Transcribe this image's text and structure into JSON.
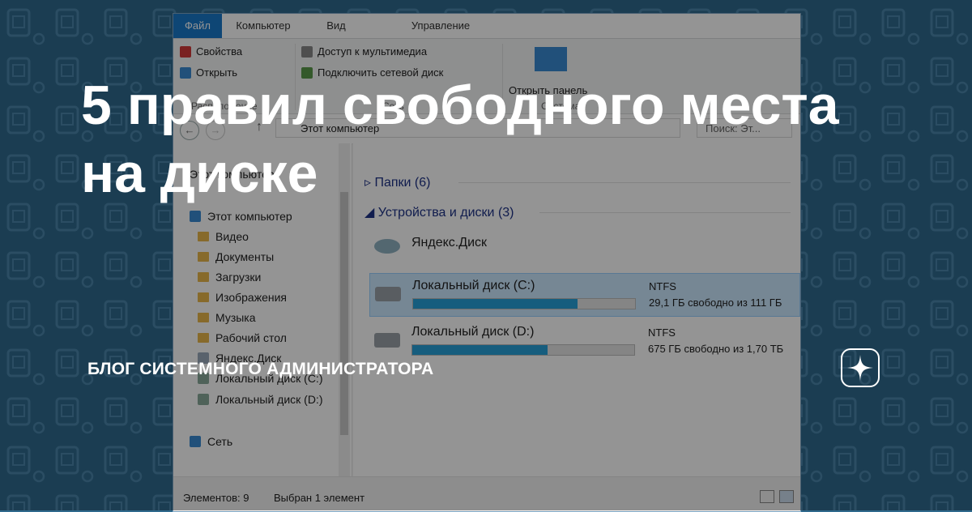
{
  "article": {
    "title": "5 правил свободного места на диске",
    "blog_name": "БЛОГ СИСТЕМНОГО АДМИНИСТРАТОРА"
  },
  "window": {
    "ribbon_tabs": [
      "Файл",
      "Компьютер",
      "Вид",
      "Управление"
    ],
    "ribbon": {
      "properties": "Свойства",
      "open": "Открыть",
      "location_group": "Расположение",
      "media_access": "Доступ к мультимедиа",
      "map_drive": "Подключить сетевой диск",
      "network_group": "Сеть",
      "control_panel": "Открыть панель",
      "system_group": "Система"
    },
    "address": {
      "path": "Этот компьютер",
      "search_placeholder": "Поиск: Эт..."
    },
    "nav_header": "Этот компьютер",
    "nav_items": [
      "Этот компьютер",
      "Видео",
      "Документы",
      "Загрузки",
      "Изображения",
      "Музыка",
      "Рабочий стол",
      "Яндекс.Диск",
      "Локальный диск (C:)",
      "Локальный диск (D:)",
      "Сеть"
    ],
    "sections": {
      "folders": "Папки (6)",
      "devices": "Устройства и диски (3)"
    },
    "drives": [
      {
        "name": "Яндекс.Диск"
      },
      {
        "name": "Локальный диск (C:)",
        "fs": "NTFS",
        "free": "29,1 ГБ свободно из 111 ГБ",
        "used_fraction": 0.74
      },
      {
        "name": "Локальный диск (D:)",
        "fs": "NTFS",
        "free": "675 ГБ свободно из 1,70 ТБ",
        "used_fraction": 0.61
      }
    ],
    "status": {
      "items": "Элементов: 9",
      "selected": "Выбран 1 элемент"
    }
  },
  "colors": {
    "background": "#2f6a8d",
    "accent": "#1979ca",
    "bar_fill": "#26a0da"
  }
}
